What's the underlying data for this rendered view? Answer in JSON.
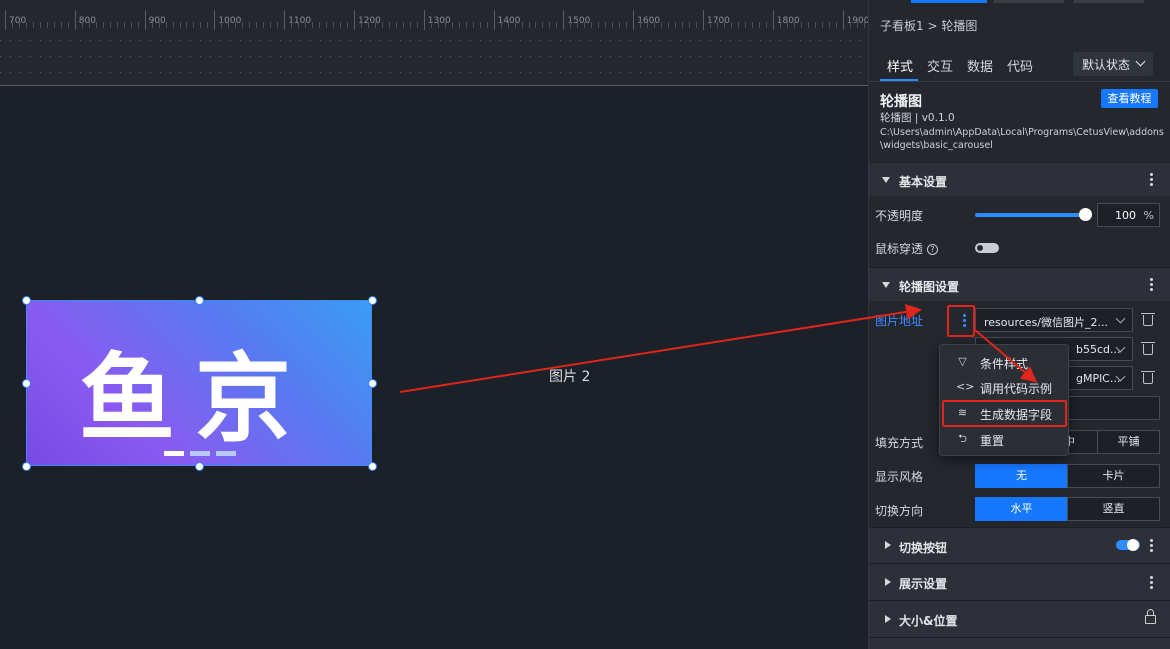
{
  "ruler": {
    "labels": [
      "700",
      "800",
      "900",
      "1000",
      "1100",
      "1200",
      "1300",
      "1400",
      "1500",
      "1600",
      "1700",
      "1800",
      "1900"
    ]
  },
  "canvas": {
    "logo_chars": [
      "鱼",
      "京"
    ],
    "image_label": "图片 2"
  },
  "panel": {
    "breadcrumb": "子看板1 > 轮播图",
    "tabs": [
      "样式",
      "交互",
      "数据",
      "代码"
    ],
    "active_tab": "样式",
    "state_select": "默认状态",
    "component": {
      "title": "轮播图",
      "version": "轮播图 | v0.1.0",
      "path": "C:\\Users\\admin\\AppData\\Local\\Programs\\CetusView\\addons\\widgets\\basic_carousel",
      "tutorial_button": "查看教程"
    },
    "basic": {
      "header": "基本设置",
      "opacity_label": "不透明度",
      "opacity_value": "100",
      "opacity_unit": "%",
      "opacity_level": 1.0,
      "mouse_through_label": "鼠标穿透",
      "help_glyph": "?",
      "mouse_through_on": false
    },
    "carousel": {
      "header": "轮播图设置",
      "image_url_label": "图片地址",
      "url_1": "resources/微信图片_2...",
      "url_2": "b55cd...",
      "url_3": "gMPlC...",
      "fill_label": "填充方式",
      "fill_opt_center": "中",
      "fill_opt_tile": "平铺",
      "style_label": "显示风格",
      "style_opts": [
        "无",
        "卡片"
      ],
      "style_active": "无",
      "direction_label": "切换方向",
      "direction_opts": [
        "水平",
        "竖直"
      ],
      "direction_active": "水平"
    },
    "menu": {
      "items": [
        "条件样式",
        "调用代码示例",
        "生成数据字段",
        "重置"
      ],
      "icons": [
        "filter-icon",
        "code-icon",
        "database-icon",
        "reset-icon"
      ],
      "icon_glyphs": [
        "▽",
        "<>",
        "≋",
        "⮌"
      ]
    },
    "sections": {
      "switch_button": "切换按钮",
      "switch_button_on": true,
      "display": "展示设置",
      "size_position": "大小&位置"
    }
  },
  "colors": {
    "accent": "#1677ff",
    "highlight": "#e0251b",
    "panel_bg": "#24272e",
    "canvas_bg": "#1b2029"
  }
}
